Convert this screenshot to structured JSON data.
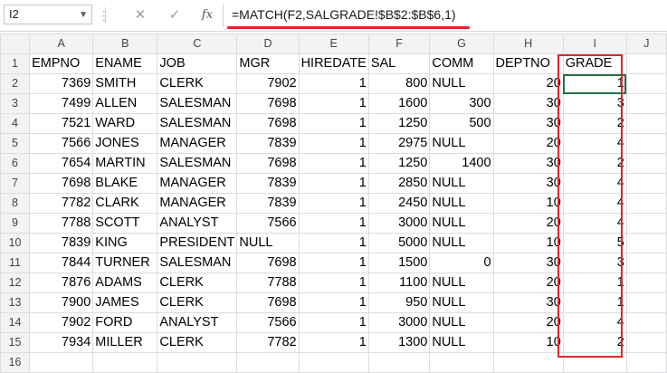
{
  "name_box": {
    "value": "I2"
  },
  "formula_bar": {
    "cancel_icon": "close-icon",
    "enter_icon": "check-icon",
    "fx_label": "fx",
    "formula": "=MATCH(F2,SALGRADE!$B$2:$B$6,1)"
  },
  "columns": [
    "A",
    "B",
    "C",
    "D",
    "E",
    "F",
    "G",
    "H",
    "I",
    "J"
  ],
  "header_row": [
    "EMPNO",
    "ENAME",
    "JOB",
    "MGR",
    "HIREDATE",
    "SAL",
    "COMM",
    "DEPTNO",
    "GRADE",
    ""
  ],
  "rows": [
    [
      "7369",
      "SMITH",
      "CLERK",
      "7902",
      "1",
      "800",
      "NULL",
      "20",
      "1",
      ""
    ],
    [
      "7499",
      "ALLEN",
      "SALESMAN",
      "7698",
      "1",
      "1600",
      "300",
      "30",
      "3",
      ""
    ],
    [
      "7521",
      "WARD",
      "SALESMAN",
      "7698",
      "1",
      "1250",
      "500",
      "30",
      "2",
      ""
    ],
    [
      "7566",
      "JONES",
      "MANAGER",
      "7839",
      "1",
      "2975",
      "NULL",
      "20",
      "4",
      ""
    ],
    [
      "7654",
      "MARTIN",
      "SALESMAN",
      "7698",
      "1",
      "1250",
      "1400",
      "30",
      "2",
      ""
    ],
    [
      "7698",
      "BLAKE",
      "MANAGER",
      "7839",
      "1",
      "2850",
      "NULL",
      "30",
      "4",
      ""
    ],
    [
      "7782",
      "CLARK",
      "MANAGER",
      "7839",
      "1",
      "2450",
      "NULL",
      "10",
      "4",
      ""
    ],
    [
      "7788",
      "SCOTT",
      "ANALYST",
      "7566",
      "1",
      "3000",
      "NULL",
      "20",
      "4",
      ""
    ],
    [
      "7839",
      "KING",
      "PRESIDENT",
      "NULL",
      "1",
      "5000",
      "NULL",
      "10",
      "5",
      ""
    ],
    [
      "7844",
      "TURNER",
      "SALESMAN",
      "7698",
      "1",
      "1500",
      "0",
      "30",
      "3",
      ""
    ],
    [
      "7876",
      "ADAMS",
      "CLERK",
      "7788",
      "1",
      "1100",
      "NULL",
      "20",
      "1",
      ""
    ],
    [
      "7900",
      "JAMES",
      "CLERK",
      "7698",
      "1",
      "950",
      "NULL",
      "30",
      "1",
      ""
    ],
    [
      "7902",
      "FORD",
      "ANALYST",
      "7566",
      "1",
      "3000",
      "NULL",
      "20",
      "4",
      ""
    ],
    [
      "7934",
      "MILLER",
      "CLERK",
      "7782",
      "1",
      "1300",
      "NULL",
      "10",
      "2",
      ""
    ]
  ],
  "colors": {
    "highlight": "#e0242c",
    "selection": "#217346"
  }
}
